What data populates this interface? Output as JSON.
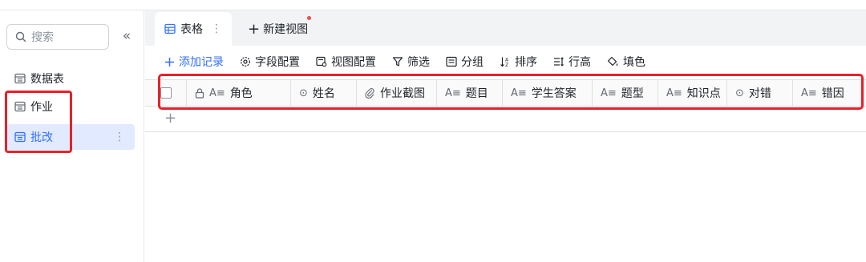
{
  "sidebar": {
    "search_placeholder": "搜索",
    "collapse_glyph": "«",
    "items": [
      {
        "label": "数据表",
        "icon": "table-icon",
        "active": false
      },
      {
        "label": "作业",
        "icon": "table-icon",
        "active": false
      },
      {
        "label": "批改",
        "icon": "table-icon",
        "active": true,
        "more": "⋮"
      }
    ]
  },
  "tabs": {
    "active": {
      "label": "表格",
      "more": "⋮"
    },
    "new_view": {
      "plus": "+",
      "label": "新建视图"
    }
  },
  "toolbar": {
    "add_record": "添加记录",
    "field_config": "字段配置",
    "view_config": "视图配置",
    "filter": "筛选",
    "group": "分组",
    "sort": "排序",
    "row_height": "行高",
    "fill_color": "填色"
  },
  "columns": [
    {
      "label": "角色",
      "type_icon": "A≡",
      "locked": true
    },
    {
      "label": "姓名",
      "type_icon": "⊙"
    },
    {
      "label": "作业截图",
      "type_icon": "attachment"
    },
    {
      "label": "题目",
      "type_icon": "A≡"
    },
    {
      "label": "学生答案",
      "type_icon": "A≡"
    },
    {
      "label": "题型",
      "type_icon": "A≡"
    },
    {
      "label": "知识点",
      "type_icon": "A≡"
    },
    {
      "label": "对错",
      "type_icon": "⊙"
    },
    {
      "label": "错因",
      "type_icon": "A≡"
    }
  ],
  "add_row_glyph": "+",
  "colors": {
    "accent": "#3370ff",
    "highlight": "#e8202a",
    "active_bg": "#e1eaff"
  }
}
